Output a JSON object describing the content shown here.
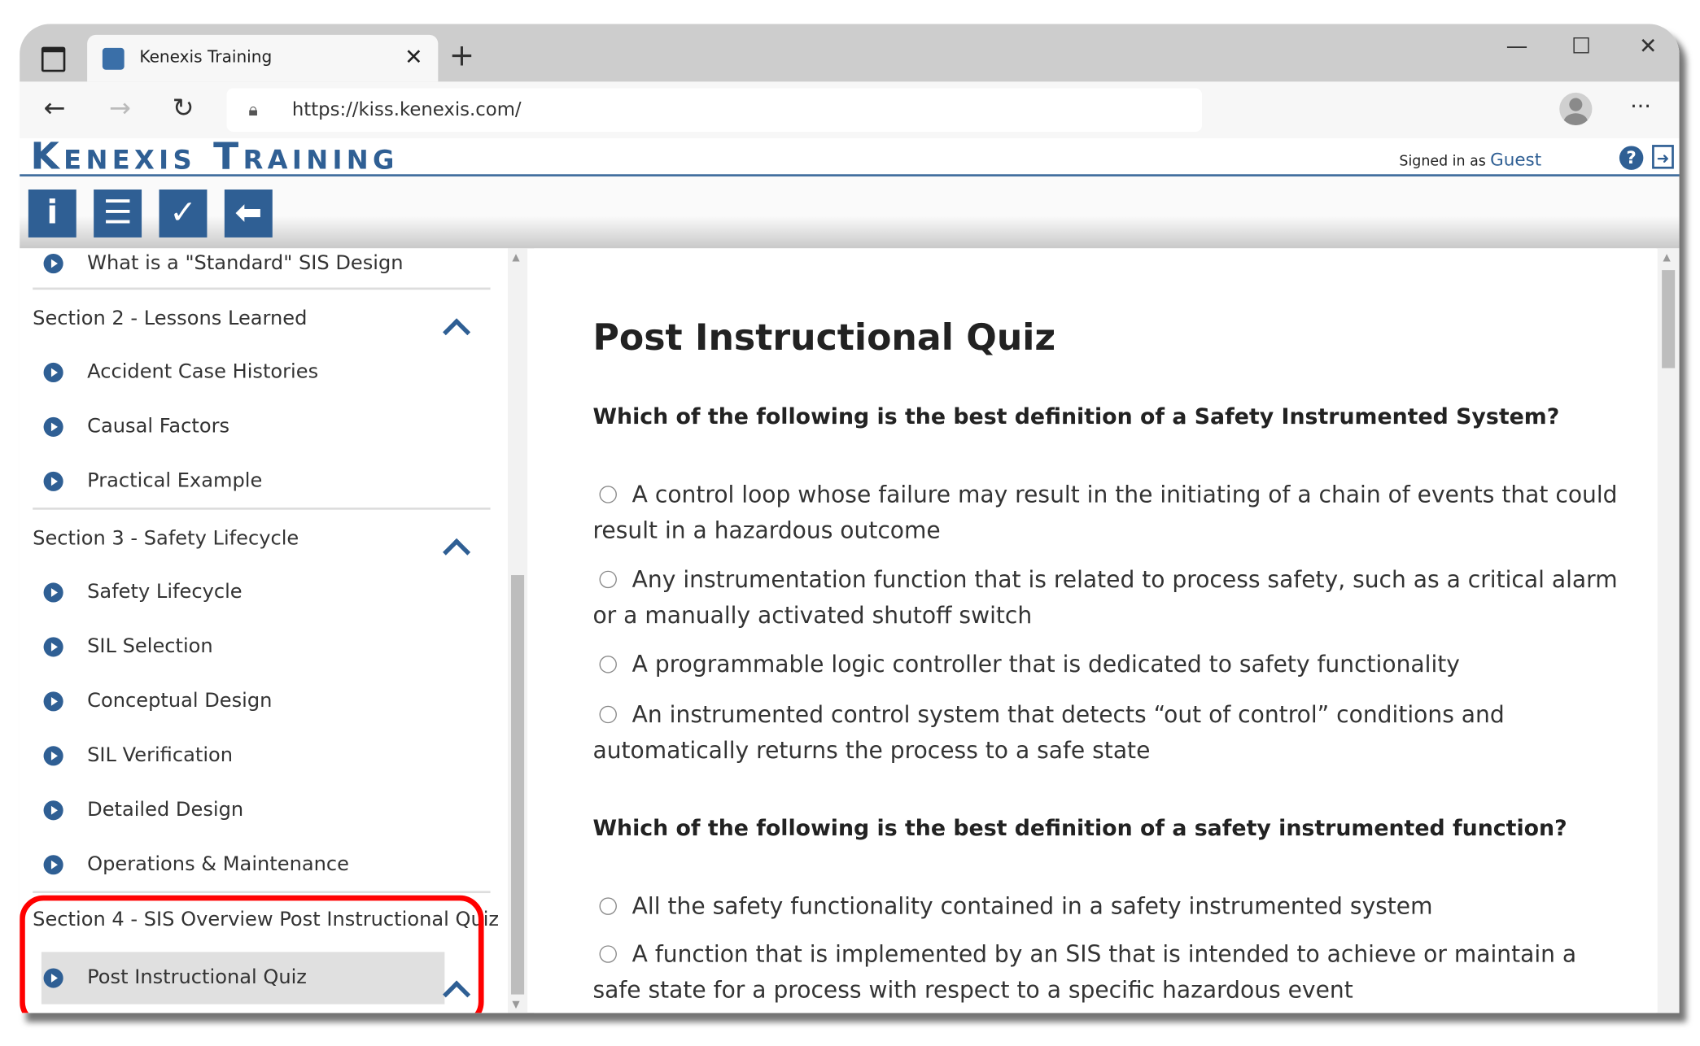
{
  "browser": {
    "tab_title": "Kenexis Training",
    "url": "https://kiss.kenexis.com/"
  },
  "header": {
    "logo": "Kenexis Training",
    "signed_in_label": "Signed in as",
    "user": "Guest"
  },
  "sidebar": {
    "top_item": "What is a \"Standard\" SIS Design",
    "sections": [
      {
        "title": "Section 2 - Lessons Learned",
        "items": [
          "Accident Case Histories",
          "Causal Factors",
          "Practical Example"
        ]
      },
      {
        "title": "Section 3 - Safety Lifecycle",
        "items": [
          "Safety Lifecycle",
          "SIL Selection",
          "Conceptual Design",
          "SIL Verification",
          "Detailed Design",
          "Operations & Maintenance"
        ]
      },
      {
        "title": "Section 4 - SIS Overview Post Instructional Quiz",
        "items": [
          "Post Instructional Quiz"
        ]
      }
    ]
  },
  "main": {
    "title": "Post Instructional Quiz",
    "questions": [
      {
        "text": "Which of the following is the best definition of a Safety Instrumented System?",
        "options": [
          "A control loop whose failure may result in the initiating of a chain of events that could result in a hazardous outcome",
          "Any instrumentation function that is related to process safety, such as a critical alarm or a manually activated shutoff switch",
          "A programmable logic controller that is dedicated to safety functionality",
          "An instrumented control system that detects “out of control” conditions and automatically returns the process to a safe state"
        ]
      },
      {
        "text": "Which of the following is the best definition of a safety instrumented function?",
        "options": [
          "All the safety functionality contained in a safety instrumented system",
          "A function that is implemented by an SIS that is intended to achieve or maintain a safe state for a process with respect to a specific hazardous event"
        ]
      }
    ]
  },
  "colors": {
    "brand": "#2f5f94",
    "highlight": "#ff0000"
  }
}
